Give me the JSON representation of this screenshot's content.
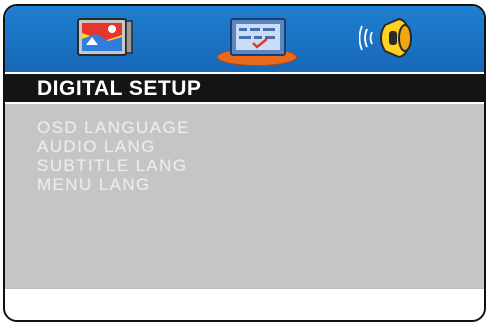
{
  "tabs": [
    {
      "icon": "tv-picture-icon"
    },
    {
      "icon": "screen-setup-icon"
    },
    {
      "icon": "speaker-audio-icon"
    }
  ],
  "header": {
    "title": "DIGITAL SETUP"
  },
  "menu": {
    "items": [
      {
        "label": "OSD LANGUAGE"
      },
      {
        "label": "AUDIO LANG"
      },
      {
        "label": "SUBTITLE LANG"
      },
      {
        "label": "MENU LANG"
      }
    ]
  },
  "colors": {
    "icon_bar": "#1a71c2",
    "header_bar": "#141414",
    "content_panel": "#c5c5c5",
    "selected_accent": "#e86a1c",
    "menu_text": "#ececec"
  }
}
